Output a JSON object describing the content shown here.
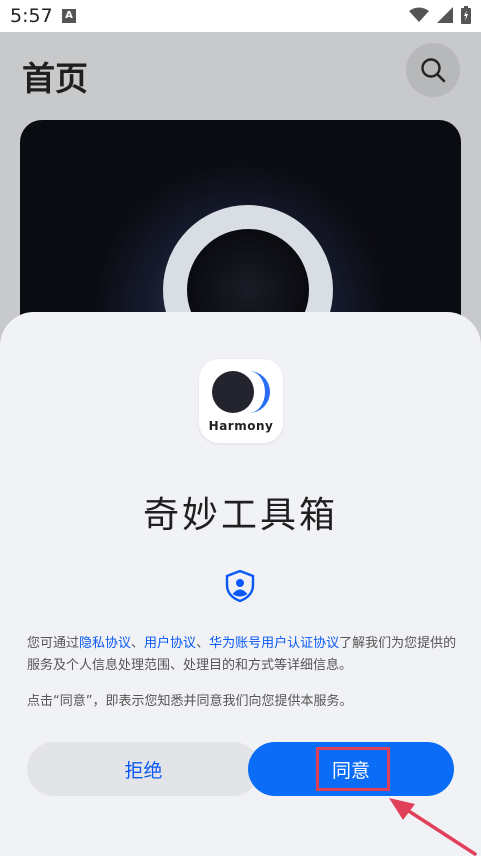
{
  "status_bar": {
    "time": "5:57",
    "a_badge": "A",
    "icons": [
      "wifi-icon",
      "signal-icon",
      "battery-icon"
    ]
  },
  "header": {
    "title": "首页",
    "search_icon": "search-icon"
  },
  "dialog": {
    "logo_text": "Harmony",
    "app_name": "奇妙工具箱",
    "policy": {
      "prefix": "您可通过",
      "link1": "隐私协议",
      "sep1": "、",
      "link2": "用户协议",
      "sep2": "、",
      "link3": "华为账号用户认证协议",
      "suffix": "了解我们为您提供的服务及个人信息处理范围、处理目的和方式等详细信息。"
    },
    "notice": "点击“同意”，即表示您知悉并同意我们向您提供本服务。",
    "reject_label": "拒绝",
    "agree_label": "同意"
  },
  "colors": {
    "accent": "#0a59f7",
    "agree_bg": "#0a6cf7",
    "annotation": "#e0405a"
  }
}
